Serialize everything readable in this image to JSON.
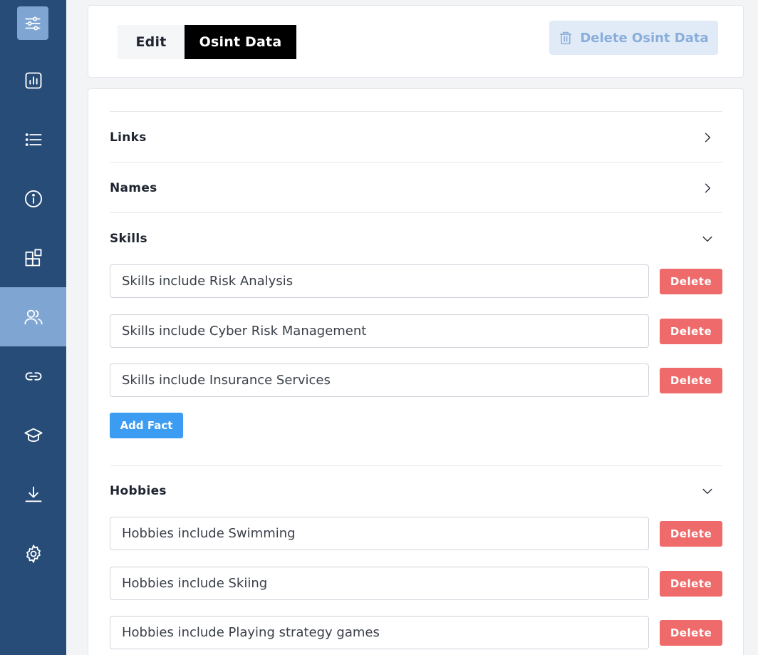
{
  "colors": {
    "sidebar_bg": "#274c78",
    "sidebar_active": "#7fa5d3",
    "delete_red": "#ef6b6b",
    "add_blue": "#3b9cf1"
  },
  "sidebar": {
    "items": [
      {
        "icon": "sliders-icon",
        "active": true
      },
      {
        "icon": "bar-chart-icon"
      },
      {
        "icon": "list-icon"
      },
      {
        "icon": "info-icon"
      },
      {
        "icon": "blocks-icon"
      },
      {
        "icon": "users-icon",
        "active": true
      },
      {
        "icon": "link-icon"
      },
      {
        "icon": "graduation-cap-icon"
      },
      {
        "icon": "download-icon"
      },
      {
        "icon": "gear-icon"
      }
    ]
  },
  "tabs": {
    "edit": "Edit",
    "osint": "Osint Data"
  },
  "header": {
    "delete_osint_label": "Delete Osint Data"
  },
  "sections": {
    "links": {
      "title": "Links"
    },
    "names": {
      "title": "Names"
    },
    "skills": {
      "title": "Skills",
      "facts": [
        "Skills include Risk Analysis",
        "Skills include Cyber Risk Management",
        "Skills include Insurance Services"
      ]
    },
    "hobbies": {
      "title": "Hobbies",
      "facts": [
        "Hobbies include Swimming",
        "Hobbies include Skiing",
        "Hobbies include Playing strategy games"
      ]
    }
  },
  "buttons": {
    "delete": "Delete",
    "add_fact": "Add Fact"
  }
}
